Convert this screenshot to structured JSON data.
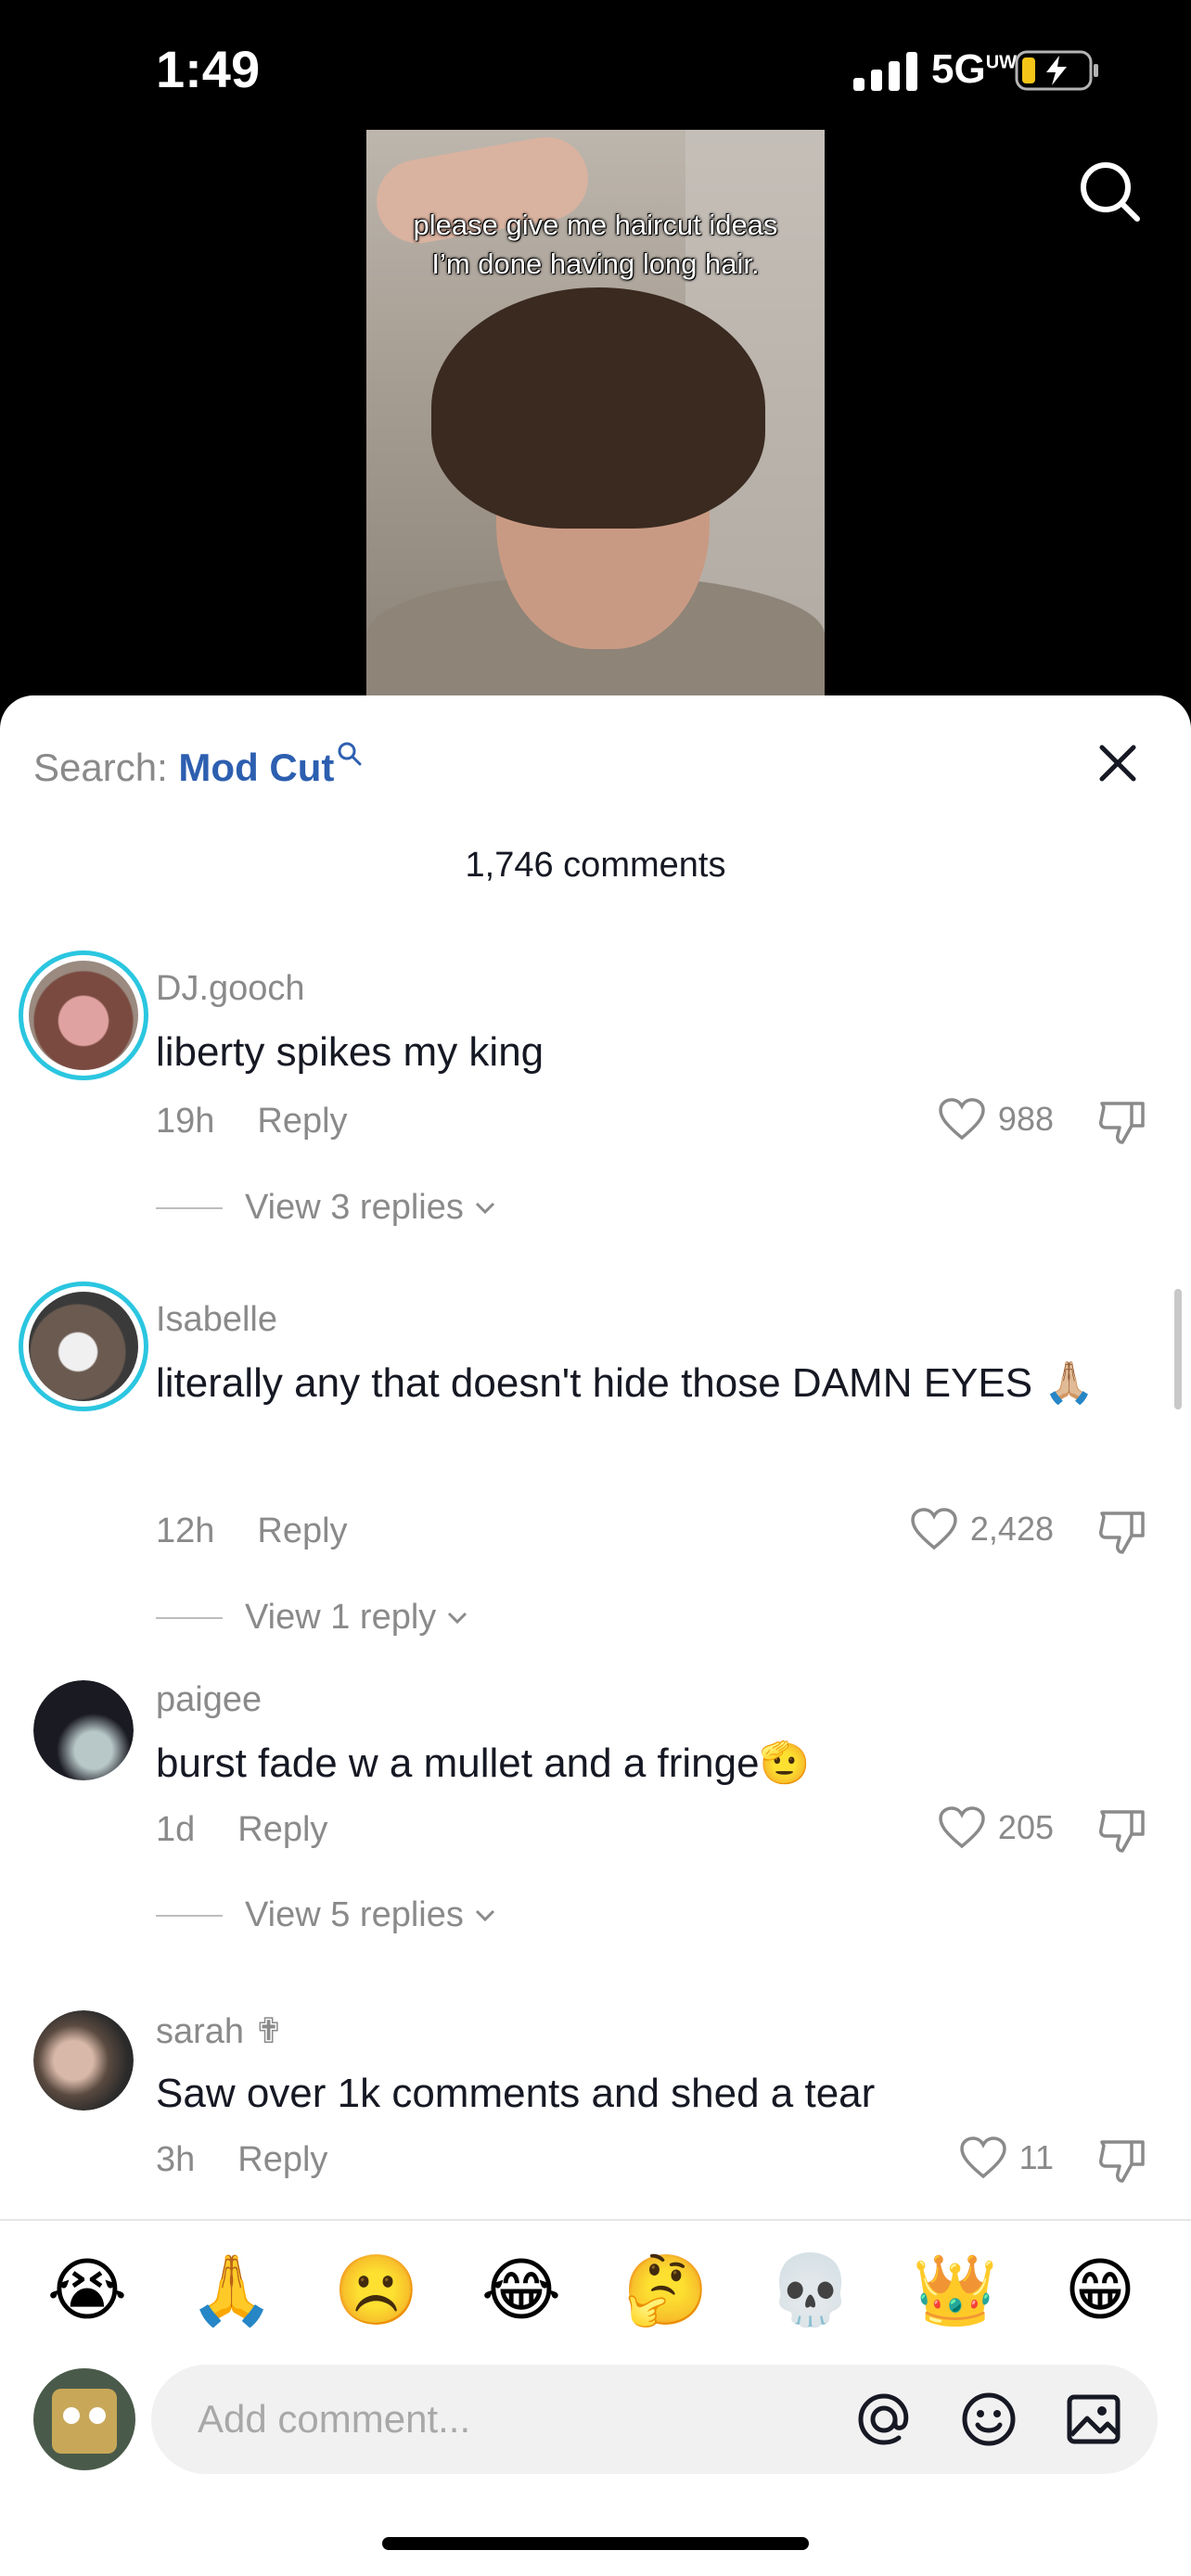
{
  "status_bar": {
    "time": "1:49",
    "network": "5G",
    "network_sub": "UW"
  },
  "video": {
    "caption_line1": "please give me haircut ideas",
    "caption_line2": "I’m done having long hair."
  },
  "header": {
    "search_prefix": "Search:",
    "search_term": "Mod Cut",
    "comment_count": "1,746 comments"
  },
  "comments": [
    {
      "username": "DJ.gooch",
      "text": "liberty spikes my king",
      "time": "19h",
      "reply": "Reply",
      "likes": "988",
      "view_replies": "View 3 replies"
    },
    {
      "username": "Isabelle",
      "text": "literally any that doesn't hide those DAMN EYES 🙏🏼",
      "time": "12h",
      "reply": "Reply",
      "likes": "2,428",
      "view_replies": "View 1 reply"
    },
    {
      "username": "paigee",
      "text": "burst fade w a mullet and a fringe🫡",
      "time": "1d",
      "reply": "Reply",
      "likes": "205",
      "view_replies": "View 5 replies"
    },
    {
      "username": "sarah ✟",
      "text": "Saw over 1k comments and shed a tear",
      "time": "3h",
      "reply": "Reply",
      "likes": "11"
    }
  ],
  "quick_emojis": [
    "😭",
    "🙏",
    "☹️",
    "😂",
    "🤔",
    "💀",
    "👑",
    "😁"
  ],
  "composer": {
    "placeholder": "Add comment..."
  },
  "colors": {
    "accent_link": "#2d5fb0",
    "avatar_ring": "#2bc6e0",
    "muted_text": "#8a8a8a"
  },
  "icons": [
    "search-icon",
    "close-icon",
    "heart-icon",
    "dislike-icon",
    "chevron-down-icon",
    "at-icon",
    "emoji-icon",
    "image-icon"
  ]
}
